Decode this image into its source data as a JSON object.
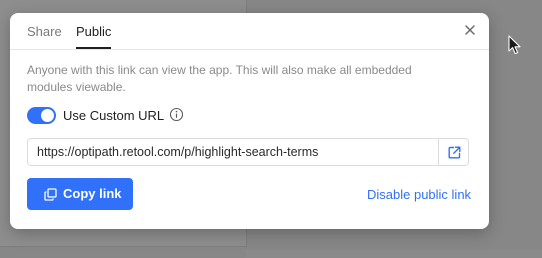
{
  "tabs": [
    {
      "label": "Share",
      "active": false
    },
    {
      "label": "Public",
      "active": true
    }
  ],
  "description": "Anyone with this link can view the app. This will also make all embedded modules viewable.",
  "custom_url": {
    "label": "Use Custom URL",
    "enabled": true
  },
  "url_field": {
    "value": "https://optipath.retool.com/p/highlight-search-terms"
  },
  "buttons": {
    "copy_link": "Copy link",
    "disable_public_link": "Disable public link"
  },
  "colors": {
    "accent": "#3170f9",
    "overlay": "#878787",
    "text": "#1f1f1f",
    "muted": "#8a8a8a"
  },
  "icons": {
    "close": "close-icon",
    "info": "info-icon",
    "open_external": "external-link-icon",
    "copy": "copy-icon",
    "cursor": "mouse-pointer-icon"
  }
}
